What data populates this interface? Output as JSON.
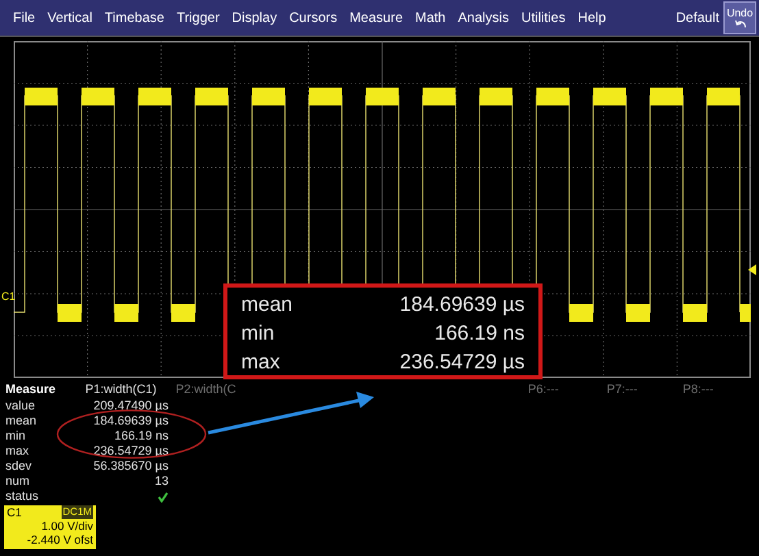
{
  "menu": {
    "items": [
      "File",
      "Vertical",
      "Timebase",
      "Trigger",
      "Display",
      "Cursors",
      "Measure",
      "Math",
      "Analysis",
      "Utilities",
      "Help"
    ],
    "default_label": "Default",
    "undo_button": "Undo"
  },
  "scope": {
    "channel_marker": "C1"
  },
  "measure": {
    "title": "Measure",
    "p1_label": "P1:width(C1)",
    "other_params": [
      "P2:width(C",
      "P6:---",
      "P7:---",
      "P8:---"
    ],
    "rows": [
      {
        "label": "value",
        "value": "209.47490 µs",
        "kind": "text"
      },
      {
        "label": "mean",
        "value": "184.69639 µs",
        "kind": "text"
      },
      {
        "label": "min",
        "value": "166.19 ns",
        "kind": "text"
      },
      {
        "label": "max",
        "value": "236.54729 µs",
        "kind": "text"
      },
      {
        "label": "sdev",
        "value": "56.385670 µs",
        "kind": "text"
      },
      {
        "label": "num",
        "value": "13",
        "kind": "text"
      },
      {
        "label": "status",
        "kind": "check"
      }
    ]
  },
  "channel_badge": {
    "name": "C1",
    "coupling": "DC1M",
    "scale": "1.00 V/div",
    "offset": "-2.440 V ofst"
  },
  "callout": {
    "rows": [
      {
        "label": "mean",
        "value": "184.69639 µs"
      },
      {
        "label": "min",
        "value": "166.19 ns"
      },
      {
        "label": "max",
        "value": "236.54729 µs"
      }
    ]
  }
}
